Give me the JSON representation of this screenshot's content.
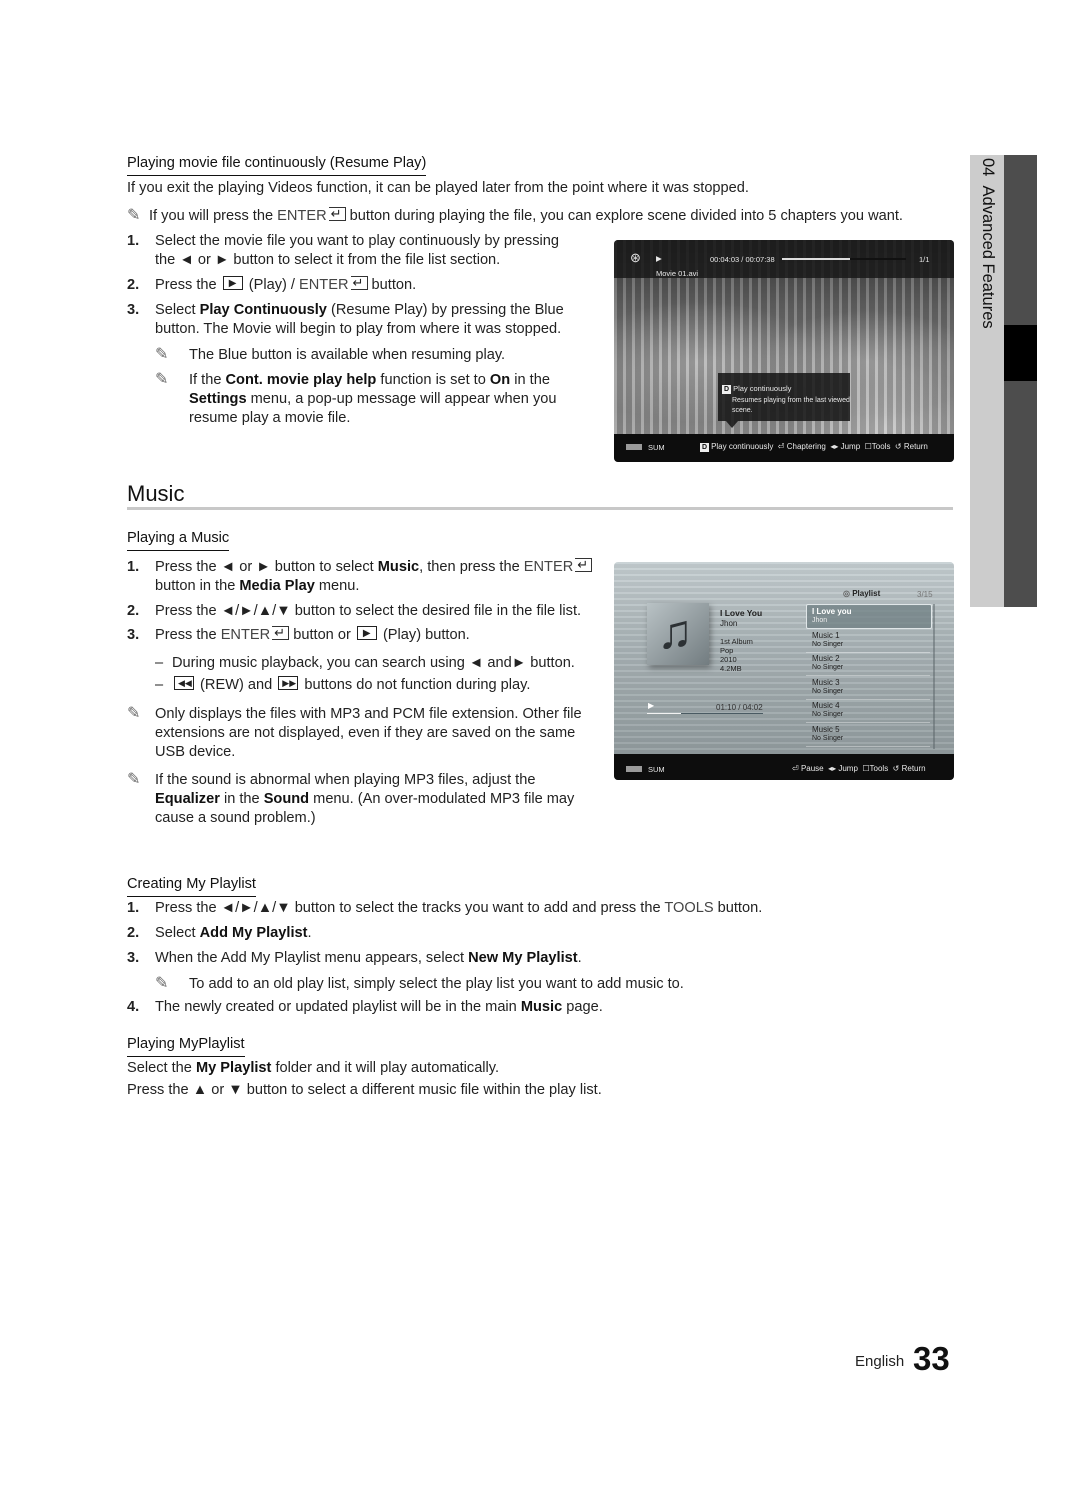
{
  "side_tab": {
    "chapter": "04",
    "title": "Advanced Features"
  },
  "resume": {
    "heading": "Playing movie file continuously (Resume Play)",
    "intro": "If you exit the playing Videos function, it can be played later from the point where it was stopped.",
    "note_pre": "If you will press the ",
    "note_key": "ENTER",
    "note_post": " button during playing the file, you can explore scene divided into 5 chapters you want.",
    "steps": [
      {
        "num": "1.",
        "line1": "Select the movie file you want to play continuously by pressing",
        "line2": "the ◄ or ► button to select it from the file list section."
      },
      {
        "num": "2.",
        "pre": "Press the ",
        "mid": " (Play) / ",
        "key": "ENTER",
        "post": " button."
      },
      {
        "num": "3.",
        "pre": "Select ",
        "bold": "Play Continuously",
        "post": " (Resume Play) by pressing the Blue",
        "line2": "button. The Movie will begin to play from where it was stopped."
      }
    ],
    "notes": [
      {
        "text": "The Blue button is available when resuming play."
      },
      {
        "pre": "If the ",
        "bold1": "Cont. movie play help",
        "mid": " function is set to ",
        "bold2": "On",
        "post": " in the",
        "bold3": "Settings",
        "line2": " menu, a pop-up message will appear when you",
        "line3": "resume play a movie file."
      }
    ]
  },
  "movie_screen": {
    "time": "00:04:03 / 00:07:38",
    "progress": 0.55,
    "counter": "1/1",
    "filename": "Movie 01.avi",
    "popup": {
      "key": "D",
      "title": "Play continuously",
      "line1": "Resumes playing from the last viewed",
      "line2": "scene."
    },
    "device": "SUM",
    "controls": [
      {
        "key": "D",
        "label": "Play continuously"
      },
      {
        "icon": "enter-icon",
        "label": "Chaptering"
      },
      {
        "icon": "left-right-icon",
        "label": "Jump"
      },
      {
        "icon": "tools-icon",
        "label": "Tools"
      },
      {
        "icon": "return-icon",
        "label": "Return"
      }
    ]
  },
  "music": {
    "heading": "Music",
    "playing_heading": "Playing a Music",
    "steps": [
      {
        "num": "1.",
        "pre": "Press the ◄ or ► button to select ",
        "bold": "Music",
        "mid": ", then press the ",
        "key": "ENTER",
        "line2_pre": "button in the ",
        "line2_bold": "Media Play",
        "line2_post": " menu."
      },
      {
        "num": "2.",
        "text": "Press the ◄/►/▲/▼ button to select the desired file in the file list."
      },
      {
        "num": "3.",
        "pre": "Press the ",
        "key": "ENTER",
        "mid": " button or ",
        "post": " (Play) button."
      }
    ],
    "dashes": [
      {
        "text": "During music playback, you can search using ◄ and► button."
      },
      {
        "mid": " (REW) and ",
        "post": " buttons do not function during play."
      }
    ],
    "notes": [
      {
        "line1": "Only displays the files with MP3 and PCM file extension. Other file",
        "line2": "extensions are not displayed, even if they are saved on the same",
        "line3": "USB device."
      },
      {
        "line1": "If the sound is abnormal when playing MP3 files, adjust the",
        "bold1": "Equalizer",
        "mid": " in the ",
        "bold2": "Sound",
        "post": " menu. (An over-modulated MP3 file may",
        "line3": "cause a sound problem.)"
      }
    ]
  },
  "music_screen": {
    "playlist_label": "Playlist",
    "playlist_count": "3/15",
    "now_playing": {
      "title": "I Love You",
      "artist": "Jhon",
      "album": "1st Album",
      "genre": "Pop",
      "year": "2010",
      "size": "4.2MB"
    },
    "time": "01:10 / 04:02",
    "progress": 0.29,
    "playlist": [
      {
        "title": "I Love you",
        "artist": "Jhon",
        "selected": true
      },
      {
        "title": "Music 1",
        "artist": "No Singer"
      },
      {
        "title": "Music 2",
        "artist": "No Singer"
      },
      {
        "title": "Music 3",
        "artist": "No Singer"
      },
      {
        "title": "Music 4",
        "artist": "No Singer"
      },
      {
        "title": "Music 5",
        "artist": "No Singer"
      }
    ],
    "device": "SUM",
    "controls": [
      {
        "icon": "enter-icon",
        "label": "Pause"
      },
      {
        "icon": "left-right-icon",
        "label": "Jump"
      },
      {
        "icon": "tools-icon",
        "label": "Tools"
      },
      {
        "icon": "return-icon",
        "label": "Return"
      }
    ]
  },
  "creating": {
    "heading": "Creating My Playlist",
    "steps": [
      {
        "num": "1.",
        "pre": "Press the ◄/►/▲/▼ button to select the tracks you want to add and press the ",
        "key": "TOOLS",
        "post": " button."
      },
      {
        "num": "2.",
        "pre": "Select ",
        "bold": "Add My Playlist",
        "post": "."
      },
      {
        "num": "3.",
        "pre": "When the Add My Playlist menu appears, select ",
        "bold": "New My Playlist",
        "post": "."
      },
      {
        "num": "4.",
        "pre": "The newly created or updated playlist will be in the main ",
        "bold": "Music",
        "post": " page."
      }
    ],
    "note": "To add to an old play list, simply select the play list you want to add music to."
  },
  "playing_playlist": {
    "heading": "Playing MyPlaylist",
    "line1_pre": "Select the ",
    "line1_bold": "My Playlist",
    "line1_post": " folder and it will play automatically.",
    "line2": "Press the ▲ or ▼ button to select a different music file within the play list."
  },
  "footer": {
    "language": "English",
    "page": "33"
  }
}
